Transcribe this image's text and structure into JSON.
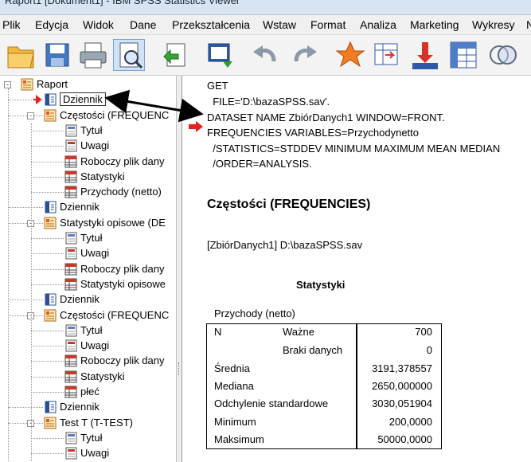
{
  "window": {
    "title": "Raport1 [Dokument1] - IBM SPSS Statistics Viewer"
  },
  "menu": [
    "Plik",
    "Edycja",
    "Widok",
    "Dane",
    "Przekształcenia",
    "Wstaw",
    "Format",
    "Analiza",
    "Marketing",
    "Wykresy",
    "N"
  ],
  "toolbar": [
    "open-folder-icon",
    "save-icon",
    "print-icon",
    "print-preview-icon",
    "export-icon",
    "go-to-data-icon",
    "undo-icon",
    "redo-icon",
    "designate-window-icon",
    "goto-case-icon",
    "insert-variable-icon",
    "pivot-table-icon",
    "venn-icon"
  ],
  "outline": {
    "items": [
      {
        "label": "Raport",
        "icon": "book-icon",
        "level": 0,
        "expander": "-"
      },
      {
        "label": "Dziennik",
        "icon": "log-icon",
        "level": 1,
        "expander": "",
        "selected": true
      },
      {
        "label": "Częstości (FREQUENC",
        "icon": "book-icon",
        "level": 1,
        "expander": "-"
      },
      {
        "label": "Tytuł",
        "icon": "title-icon",
        "level": 2,
        "expander": ""
      },
      {
        "label": "Uwagi",
        "icon": "notes-icon",
        "level": 2,
        "expander": ""
      },
      {
        "label": "Roboczy plik dany",
        "icon": "table-icon",
        "level": 2,
        "expander": ""
      },
      {
        "label": "Statystyki",
        "icon": "table-icon",
        "level": 2,
        "expander": ""
      },
      {
        "label": "Przychody (netto)",
        "icon": "table-icon",
        "level": 2,
        "expander": ""
      },
      {
        "label": "Dziennik",
        "icon": "log-icon",
        "level": 1,
        "expander": ""
      },
      {
        "label": "Statystyki opisowe (DE",
        "icon": "book-icon",
        "level": 1,
        "expander": "-"
      },
      {
        "label": "Tytuł",
        "icon": "title-icon",
        "level": 2,
        "expander": ""
      },
      {
        "label": "Uwagi",
        "icon": "notes-icon",
        "level": 2,
        "expander": ""
      },
      {
        "label": "Roboczy plik dany",
        "icon": "table-icon",
        "level": 2,
        "expander": ""
      },
      {
        "label": "Statystyki opisowe",
        "icon": "table-icon",
        "level": 2,
        "expander": ""
      },
      {
        "label": "Dziennik",
        "icon": "log-icon",
        "level": 1,
        "expander": ""
      },
      {
        "label": "Częstości (FREQUENC",
        "icon": "book-icon",
        "level": 1,
        "expander": "-"
      },
      {
        "label": "Tytuł",
        "icon": "title-icon",
        "level": 2,
        "expander": ""
      },
      {
        "label": "Uwagi",
        "icon": "notes-icon",
        "level": 2,
        "expander": ""
      },
      {
        "label": "Roboczy plik dany",
        "icon": "table-icon",
        "level": 2,
        "expander": ""
      },
      {
        "label": "Statystyki",
        "icon": "table-icon",
        "level": 2,
        "expander": ""
      },
      {
        "label": "płeć",
        "icon": "table-icon",
        "level": 2,
        "expander": ""
      },
      {
        "label": "Dziennik",
        "icon": "log-icon",
        "level": 1,
        "expander": ""
      },
      {
        "label": "Test T (T-TEST)",
        "icon": "book-icon",
        "level": 1,
        "expander": "-"
      },
      {
        "label": "Tytuł",
        "icon": "title-icon",
        "level": 2,
        "expander": ""
      },
      {
        "label": "Uwagi",
        "icon": "notes-icon",
        "level": 2,
        "expander": ""
      }
    ]
  },
  "content": {
    "syntax": [
      "GET",
      "  FILE='D:\\bazaSPSS.sav'.",
      "DATASET NAME ZbiórDanych1 WINDOW=FRONT.",
      "FREQUENCIES VARIABLES=Przychodynetto",
      "  /STATISTICS=STDDEV MINIMUM MAXIMUM MEAN MEDIAN",
      "  /ORDER=ANALYSIS."
    ],
    "heading": "Częstości (FREQUENCIES)",
    "dataset": "[ZbiórDanych1] D:\\bazaSPSS.sav",
    "table": {
      "title": "Statystyki",
      "variable": "Przychody (netto)",
      "rows": [
        {
          "label": "N",
          "sublabel": "Ważne",
          "value": "700"
        },
        {
          "label": "",
          "sublabel": "Braki danych",
          "value": "0"
        },
        {
          "label": "Średnia",
          "sublabel": "",
          "value": "3191,378557"
        },
        {
          "label": "Mediana",
          "sublabel": "",
          "value": "2650,000000"
        },
        {
          "label": "Odchylenie standardowe",
          "sublabel": "",
          "value": "3030,051904"
        },
        {
          "label": "Minimum",
          "sublabel": "",
          "value": "200,0000"
        },
        {
          "label": "Maksimum",
          "sublabel": "",
          "value": "50000,0000"
        }
      ]
    }
  },
  "colors": {
    "marker_red": "#e8201c",
    "book_orange": "#f08a1c",
    "log_blue": "#2a4f9a"
  }
}
